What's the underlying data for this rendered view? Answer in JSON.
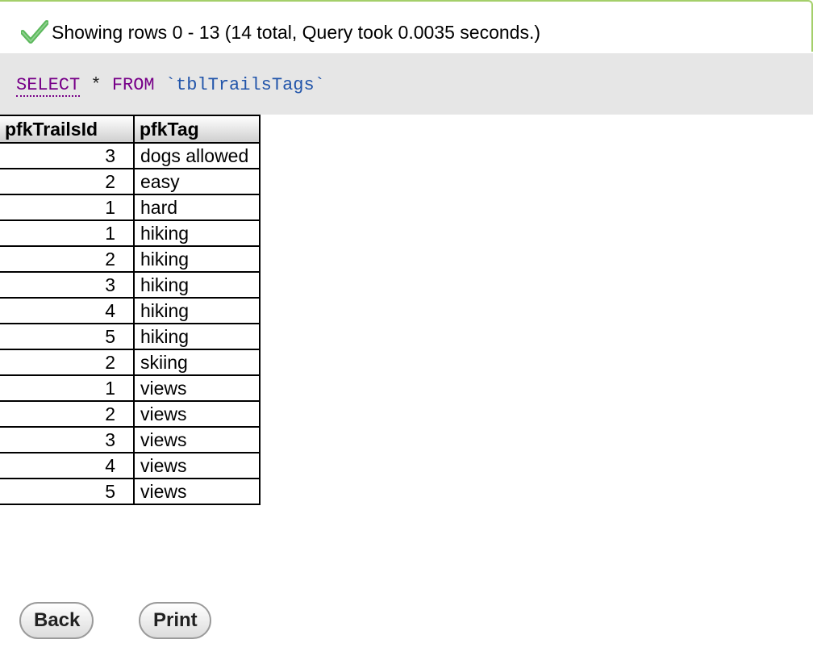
{
  "status": {
    "message": "Showing rows 0 - 13 (14 total, Query took 0.0035 seconds.)",
    "icon": "check-icon",
    "accent_color": "#5cb85c"
  },
  "sql": {
    "select_keyword": "SELECT",
    "star": " * ",
    "from_keyword": "FROM",
    "space": " ",
    "table_name": "`tblTrailsTags`"
  },
  "table": {
    "headers": [
      "pfkTrailsId",
      "pfkTag"
    ],
    "rows": [
      [
        "3",
        "dogs allowed"
      ],
      [
        "2",
        "easy"
      ],
      [
        "1",
        "hard"
      ],
      [
        "1",
        "hiking"
      ],
      [
        "2",
        "hiking"
      ],
      [
        "3",
        "hiking"
      ],
      [
        "4",
        "hiking"
      ],
      [
        "5",
        "hiking"
      ],
      [
        "2",
        "skiing"
      ],
      [
        "1",
        "views"
      ],
      [
        "2",
        "views"
      ],
      [
        "3",
        "views"
      ],
      [
        "4",
        "views"
      ],
      [
        "5",
        "views"
      ]
    ]
  },
  "buttons": {
    "back_label": "Back",
    "print_label": "Print"
  }
}
